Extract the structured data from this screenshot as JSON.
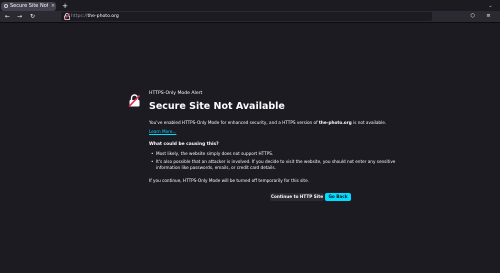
{
  "tabbar": {
    "tab_title": "Secure Site Not Available",
    "tab_close": "×",
    "new_tab": "+",
    "tab_list": "⌄"
  },
  "navbar": {
    "back": "←",
    "forward": "→",
    "reload": "↻",
    "url_scheme": "https://",
    "url_host": "the-photo.org",
    "lock": "🔓",
    "extensions": "⬡",
    "menu": "≡"
  },
  "page": {
    "alert_label": "HTTPS-Only Mode Alert",
    "title": "Secure Site Not Available",
    "intro_prefix": "You've enabled HTTPS-Only Mode for enhanced security, and a HTTPS version of ",
    "intro_host": "the-photo.org",
    "intro_suffix": " is not available.",
    "learn_more": "Learn More...",
    "causes_heading": "What could be causing this?",
    "reason_1": "Most likely, the website simply does not support HTTPS.",
    "reason_2": "It's also possible that an attacker is involved. If you decide to visit the website, you should not enter any sensitive information like passwords, emails, or credit card details.",
    "continue_note": "If you continue, HTTPS-Only Mode will be turned off temporarily for this site.",
    "continue_button": "Continue to HTTP Site",
    "back_button": "Go Back"
  },
  "colors": {
    "background": "#1c1b22",
    "accent": "#00ddff",
    "icon_red": "#e22850"
  },
  "icons": {
    "warning": "broken-lock-icon"
  }
}
